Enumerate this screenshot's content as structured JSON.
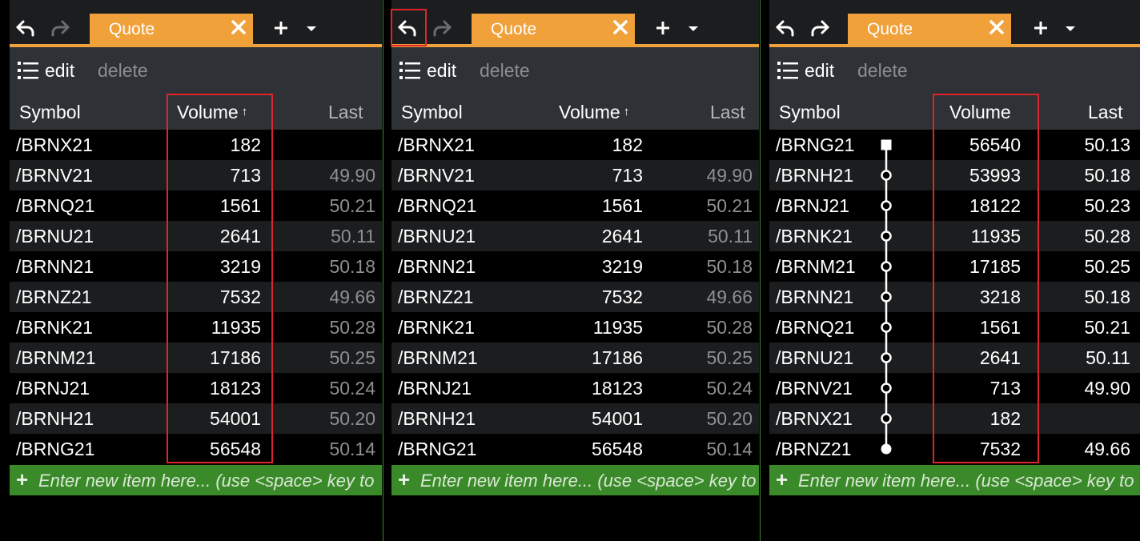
{
  "common": {
    "tab_title": "Quote",
    "edit_label": "edit",
    "delete_label": "delete",
    "col_symbol": "Symbol",
    "col_volume": "Volume",
    "col_last": "Last",
    "sort_up": "↑",
    "entry_placeholder": "Enter new item here... (use <space> key to"
  },
  "panel1": {
    "rows": [
      {
        "symbol": "/BRNX21",
        "volume": "182",
        "last": ""
      },
      {
        "symbol": "/BRNV21",
        "volume": "713",
        "last": "49.90"
      },
      {
        "symbol": "/BRNQ21",
        "volume": "1561",
        "last": "50.21"
      },
      {
        "symbol": "/BRNU21",
        "volume": "2641",
        "last": "50.11"
      },
      {
        "symbol": "/BRNN21",
        "volume": "3219",
        "last": "50.18"
      },
      {
        "symbol": "/BRNZ21",
        "volume": "7532",
        "last": "49.66"
      },
      {
        "symbol": "/BRNK21",
        "volume": "11935",
        "last": "50.28"
      },
      {
        "symbol": "/BRNM21",
        "volume": "17186",
        "last": "50.25"
      },
      {
        "symbol": "/BRNJ21",
        "volume": "18123",
        "last": "50.24"
      },
      {
        "symbol": "/BRNH21",
        "volume": "54001",
        "last": "50.20"
      },
      {
        "symbol": "/BRNG21",
        "volume": "56548",
        "last": "50.14"
      }
    ]
  },
  "panel2": {
    "rows": [
      {
        "symbol": "/BRNX21",
        "volume": "182",
        "last": ""
      },
      {
        "symbol": "/BRNV21",
        "volume": "713",
        "last": "49.90"
      },
      {
        "symbol": "/BRNQ21",
        "volume": "1561",
        "last": "50.21"
      },
      {
        "symbol": "/BRNU21",
        "volume": "2641",
        "last": "50.11"
      },
      {
        "symbol": "/BRNN21",
        "volume": "3219",
        "last": "50.18"
      },
      {
        "symbol": "/BRNZ21",
        "volume": "7532",
        "last": "49.66"
      },
      {
        "symbol": "/BRNK21",
        "volume": "11935",
        "last": "50.28"
      },
      {
        "symbol": "/BRNM21",
        "volume": "17186",
        "last": "50.25"
      },
      {
        "symbol": "/BRNJ21",
        "volume": "18123",
        "last": "50.24"
      },
      {
        "symbol": "/BRNH21",
        "volume": "54001",
        "last": "50.20"
      },
      {
        "symbol": "/BRNG21",
        "volume": "56548",
        "last": "50.14"
      }
    ]
  },
  "panel3": {
    "rows": [
      {
        "symbol": "/BRNG21",
        "volume": "56540",
        "last": "50.13"
      },
      {
        "symbol": "/BRNH21",
        "volume": "53993",
        "last": "50.18"
      },
      {
        "symbol": "/BRNJ21",
        "volume": "18122",
        "last": "50.23"
      },
      {
        "symbol": "/BRNK21",
        "volume": "11935",
        "last": "50.28"
      },
      {
        "symbol": "/BRNM21",
        "volume": "17185",
        "last": "50.25"
      },
      {
        "symbol": "/BRNN21",
        "volume": "3218",
        "last": "50.18"
      },
      {
        "symbol": "/BRNQ21",
        "volume": "1561",
        "last": "50.21"
      },
      {
        "symbol": "/BRNU21",
        "volume": "2641",
        "last": "50.11"
      },
      {
        "symbol": "/BRNV21",
        "volume": "713",
        "last": "49.90"
      },
      {
        "symbol": "/BRNX21",
        "volume": "182",
        "last": ""
      },
      {
        "symbol": "/BRNZ21",
        "volume": "7532",
        "last": "49.66"
      }
    ]
  },
  "colors": {
    "accent": "#f0a13a",
    "highlight_box": "#e0242a",
    "entry_bar": "#3a8a2a"
  }
}
